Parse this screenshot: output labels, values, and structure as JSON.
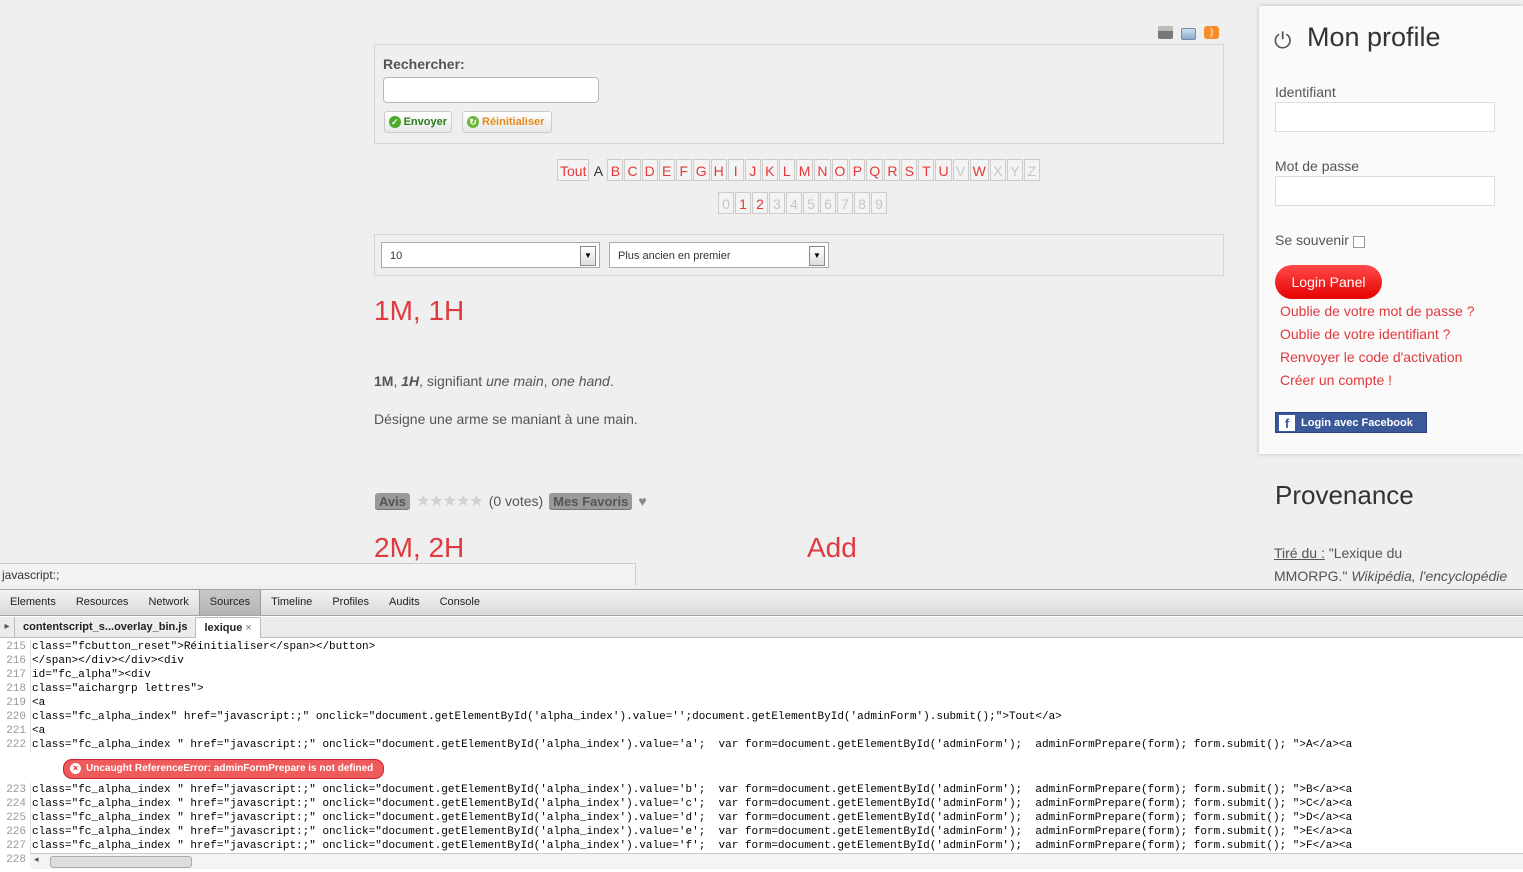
{
  "toolbar_icons": [
    "print-icon",
    "email-icon",
    "rss-icon"
  ],
  "search": {
    "label": "Rechercher:",
    "value": "",
    "submit_label": "Envoyer",
    "reset_label": "Réinitialiser"
  },
  "alpha_index": [
    "Tout",
    "A",
    "B",
    "C",
    "D",
    "E",
    "F",
    "G",
    "H",
    "I",
    "J",
    "K",
    "L",
    "M",
    "N",
    "O",
    "P",
    "Q",
    "R",
    "S",
    "T",
    "U",
    "V",
    "W",
    "X",
    "Y",
    "Z"
  ],
  "alpha_disabled": [
    "V",
    "X",
    "Y",
    "Z"
  ],
  "alpha_plain": [
    "A"
  ],
  "num_index": [
    "0",
    "1",
    "2",
    "3",
    "4",
    "5",
    "6",
    "7",
    "8",
    "9"
  ],
  "num_enabled": [
    "1",
    "2"
  ],
  "filters": {
    "limit": "10",
    "order": "Plus ancien en premier"
  },
  "entry1": {
    "title": "1M, 1H",
    "abbr1": "1M",
    "sep": ", ",
    "abbr2": "1H",
    "meaning_prefix": ", signifiant ",
    "meaning_fr": "une main",
    "meaning_sep": ", ",
    "meaning_en": "one hand",
    "meaning_end": ".",
    "desc": "Désigne une arme se maniant à une main.",
    "avis_label": "Avis",
    "votes": "(0 votes)",
    "favoris_label": "Mes Favoris"
  },
  "entry2": {
    "title": "2M, 2H",
    "add_label": "Add"
  },
  "profile": {
    "title": "Mon profile",
    "username_label": "Identifiant",
    "password_label": "Mot de passe",
    "remember_label": "Se souvenir",
    "login_label": "Login Panel",
    "links": [
      "Oublie de votre mot de passe ?",
      "Oublie de votre identifiant ?",
      "Renvoyer le code d'activation",
      "Créer un compte !"
    ],
    "facebook_label": "Login avec Facebook"
  },
  "provenance": {
    "title": "Provenance",
    "source_label": "Tiré du :",
    "source_text_1": " \"Lexique du",
    "source_text_2": "MMORPG.\" ",
    "source_italic": "Wikipédia, l'encyclopédie"
  },
  "status_bar": "javascript:;",
  "devtools": {
    "tabs": [
      "Elements",
      "Resources",
      "Network",
      "Sources",
      "Timeline",
      "Profiles",
      "Audits",
      "Console"
    ],
    "active_tab": "Sources",
    "files": [
      "contentscript_s...overlay_bin.js",
      "lexique"
    ],
    "active_file": "lexique",
    "lines": [
      {
        "n": "215",
        "t": "class=\"fcbutton_reset\">Réinitialiser</span></button>"
      },
      {
        "n": "216",
        "t": "</span></div></div><div"
      },
      {
        "n": "217",
        "t": "id=\"fc_alpha\"><div"
      },
      {
        "n": "218",
        "t": "class=\"aichargrp lettres\">"
      },
      {
        "n": "219",
        "t": "<a"
      },
      {
        "n": "220",
        "t": "class=\"fc_alpha_index\" href=\"javascript:;\" onclick=\"document.getElementById('alpha_index').value='';document.getElementById('adminForm').submit();\">Tout</a>"
      },
      {
        "n": "221",
        "t": "<a"
      },
      {
        "n": "222",
        "t": "class=\"fc_alpha_index \" href=\"javascript:;\" onclick=\"document.getElementById('alpha_index').value='a';  var form=document.getElementById('adminForm');  adminFormPrepare(form); form.submit(); \">A</a><a"
      }
    ],
    "error": "Uncaught ReferenceError: adminFormPrepare is not defined",
    "lines2": [
      {
        "n": "223",
        "t": "class=\"fc_alpha_index \" href=\"javascript:;\" onclick=\"document.getElementById('alpha_index').value='b';  var form=document.getElementById('adminForm');  adminFormPrepare(form); form.submit(); \">B</a><a"
      },
      {
        "n": "224",
        "t": "class=\"fc_alpha_index \" href=\"javascript:;\" onclick=\"document.getElementById('alpha_index').value='c';  var form=document.getElementById('adminForm');  adminFormPrepare(form); form.submit(); \">C</a><a"
      },
      {
        "n": "225",
        "t": "class=\"fc_alpha_index \" href=\"javascript:;\" onclick=\"document.getElementById('alpha_index').value='d';  var form=document.getElementById('adminForm');  adminFormPrepare(form); form.submit(); \">D</a><a"
      },
      {
        "n": "226",
        "t": "class=\"fc_alpha_index \" href=\"javascript:;\" onclick=\"document.getElementById('alpha_index').value='e';  var form=document.getElementById('adminForm');  adminFormPrepare(form); form.submit(); \">E</a><a"
      },
      {
        "n": "227",
        "t": "class=\"fc_alpha_index \" href=\"javascript:;\" onclick=\"document.getElementById('alpha_index').value='f';  var form=document.getElementById('adminForm');  adminFormPrepare(form); form.submit(); \">F</a><a"
      },
      {
        "n": "228",
        "t": ""
      }
    ]
  },
  "colors": {
    "accent": "#e0393e",
    "facebook": "#3b5998"
  }
}
